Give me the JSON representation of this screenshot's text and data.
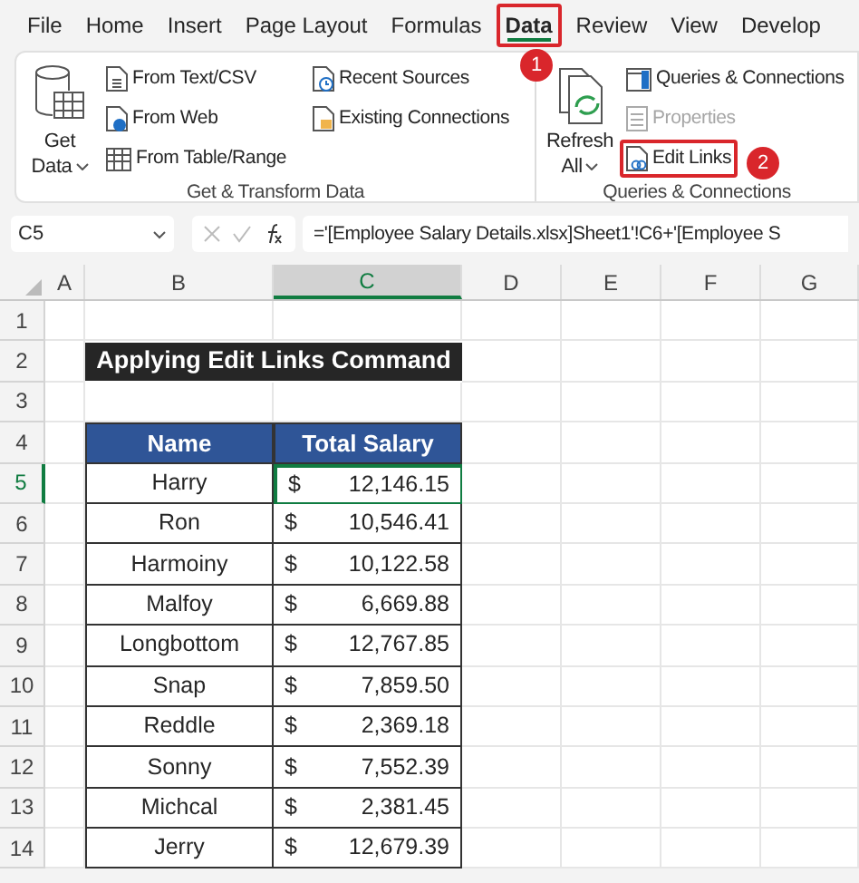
{
  "menu_tabs": [
    {
      "label": "File",
      "selected": false
    },
    {
      "label": "Home",
      "selected": false
    },
    {
      "label": "Insert",
      "selected": false
    },
    {
      "label": "Page Layout",
      "selected": false
    },
    {
      "label": "Formulas",
      "selected": false
    },
    {
      "label": "Data",
      "selected": true
    },
    {
      "label": "Review",
      "selected": false
    },
    {
      "label": "View",
      "selected": false
    },
    {
      "label": "Develop",
      "selected": false
    }
  ],
  "ribbon": {
    "groups": [
      {
        "title": "Get & Transform Data",
        "big_button": {
          "lines": [
            "Get",
            "Data"
          ],
          "kind": "database"
        },
        "columns": [
          [
            {
              "label": "From Text/CSV",
              "kind": "text",
              "disabled": false,
              "highlighted": false
            },
            {
              "label": "From Web",
              "kind": "web",
              "disabled": false,
              "highlighted": false
            },
            {
              "label": "From Table/Range",
              "kind": "table",
              "disabled": false,
              "highlighted": false
            }
          ],
          [
            {
              "label": "Recent Sources",
              "kind": "clock",
              "disabled": false,
              "highlighted": false
            },
            {
              "label": "Existing Connections",
              "kind": "folder",
              "disabled": false,
              "highlighted": false
            }
          ]
        ]
      },
      {
        "title": "Queries & Connections",
        "big_button": {
          "lines": [
            "Refresh",
            "All"
          ],
          "kind": "refresh"
        },
        "columns": [
          [
            {
              "label": "Queries & Connections",
              "kind": "panel",
              "disabled": false,
              "highlighted": false
            },
            {
              "label": "Properties",
              "kind": "props",
              "disabled": true,
              "highlighted": false
            },
            {
              "label": "Edit Links",
              "kind": "link",
              "disabled": false,
              "highlighted": true
            }
          ]
        ]
      }
    ]
  },
  "step_badges": [
    "1",
    "2"
  ],
  "formula_bar": {
    "name_box": "C5",
    "formula": "='[Employee Salary Details.xlsx]Sheet1'!C6+'[Employee S"
  },
  "columns": [
    {
      "label": "A",
      "selected": false
    },
    {
      "label": "B",
      "selected": false
    },
    {
      "label": "C",
      "selected": true
    },
    {
      "label": "D",
      "selected": false
    },
    {
      "label": "E",
      "selected": false
    },
    {
      "label": "F",
      "selected": false
    },
    {
      "label": "G",
      "selected": false
    }
  ],
  "row_numbers": [
    {
      "label": "1",
      "selected": false
    },
    {
      "label": "2",
      "selected": false
    },
    {
      "label": "3",
      "selected": false
    },
    {
      "label": "4",
      "selected": false
    },
    {
      "label": "5",
      "selected": true
    },
    {
      "label": "6",
      "selected": false
    },
    {
      "label": "7",
      "selected": false
    },
    {
      "label": "8",
      "selected": false
    },
    {
      "label": "9",
      "selected": false
    },
    {
      "label": "10",
      "selected": false
    },
    {
      "label": "11",
      "selected": false
    },
    {
      "label": "12",
      "selected": false
    },
    {
      "label": "13",
      "selected": false
    },
    {
      "label": "14",
      "selected": false
    }
  ],
  "sheet": {
    "title": "Applying Edit Links Command",
    "headers": [
      "Name",
      "Total Salary"
    ],
    "records": [
      {
        "name": "Harry",
        "currency": "$",
        "salary": "12,146.15",
        "selected": true
      },
      {
        "name": "Ron",
        "currency": "$",
        "salary": "10,546.41",
        "selected": false
      },
      {
        "name": "Harmoiny",
        "currency": "$",
        "salary": "10,122.58",
        "selected": false
      },
      {
        "name": "Malfoy",
        "currency": "$",
        "salary": "6,669.88",
        "selected": false
      },
      {
        "name": "Longbottom",
        "currency": "$",
        "salary": "12,767.85",
        "selected": false
      },
      {
        "name": "Snap",
        "currency": "$",
        "salary": "7,859.50",
        "selected": false
      },
      {
        "name": "Reddle",
        "currency": "$",
        "salary": "2,369.18",
        "selected": false
      },
      {
        "name": "Sonny",
        "currency": "$",
        "salary": "7,552.39",
        "selected": false
      },
      {
        "name": "Michcal",
        "currency": "$",
        "salary": "2,381.45",
        "selected": false
      },
      {
        "name": "Jerry",
        "currency": "$",
        "salary": "12,679.39",
        "selected": false
      }
    ]
  }
}
